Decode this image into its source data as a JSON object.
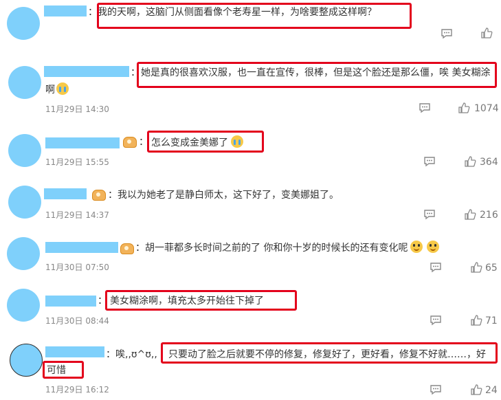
{
  "comments": [
    {
      "line1": "：我的天啊，这脑门从侧面看像个老寿星一样，为啥要整成这样啊？"
    },
    {
      "colon": "：",
      "line1": "她是真的很喜欢汉服，也一直在宣传，很棒，但是这个脸还是那么僵，唉 美女糊涂",
      "line2": "啊",
      "date": "11月29日 14:30",
      "likes": "1074"
    },
    {
      "colon": "：",
      "line1": "怎么变成金美娜了",
      "date": "11月29日 15:55",
      "likes": "364"
    },
    {
      "line1": "：我以为她老了是静白师太，这下好了，变美娜姐了。",
      "date": "11月29日 14:37",
      "likes": "216"
    },
    {
      "line1": "：胡一菲都多长时间之前的了 你和你十岁的时候长的还有变化呢",
      "date": "11月30日 07:50",
      "likes": "65"
    },
    {
      "colon": "：",
      "line1": "美女糊涂啊，填充太多开始往下掉了",
      "date": "11月30日 08:44",
      "likes": "71"
    },
    {
      "prefix": "：唉,,ʊ^ʊ,,",
      "line1": "只要动了脸之后就要不停的修复，修复好了，更好看，修复不好就……，好",
      "line2": "可惜",
      "date": "11月29日 16:12",
      "likes": "24"
    }
  ],
  "icons": {
    "comment": "comment-icon",
    "like": "thumbs-up-icon",
    "avatar_badge": "vip-crown-badge",
    "emoji_cry": "crying-face-emoji",
    "emoji_smile": "smiling-face-emoji"
  },
  "colors": {
    "highlight_border": "#e3001b",
    "avatar_placeholder": "#7fd0fb"
  }
}
